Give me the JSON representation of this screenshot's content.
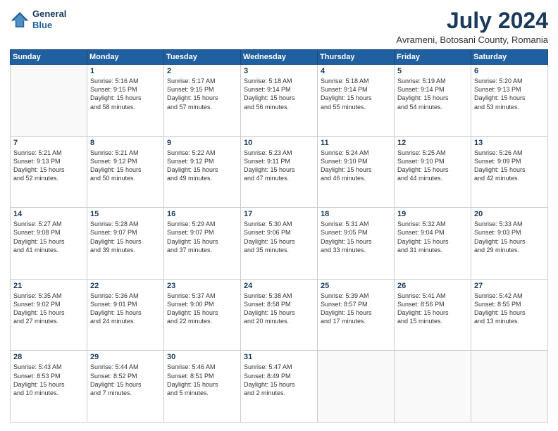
{
  "logo": {
    "line1": "General",
    "line2": "Blue"
  },
  "title": "July 2024",
  "subtitle": "Avrameni, Botosani County, Romania",
  "weekdays": [
    "Sunday",
    "Monday",
    "Tuesday",
    "Wednesday",
    "Thursday",
    "Friday",
    "Saturday"
  ],
  "weeks": [
    [
      {
        "day": "",
        "text": ""
      },
      {
        "day": "1",
        "text": "Sunrise: 5:16 AM\nSunset: 9:15 PM\nDaylight: 15 hours\nand 58 minutes."
      },
      {
        "day": "2",
        "text": "Sunrise: 5:17 AM\nSunset: 9:15 PM\nDaylight: 15 hours\nand 57 minutes."
      },
      {
        "day": "3",
        "text": "Sunrise: 5:18 AM\nSunset: 9:14 PM\nDaylight: 15 hours\nand 56 minutes."
      },
      {
        "day": "4",
        "text": "Sunrise: 5:18 AM\nSunset: 9:14 PM\nDaylight: 15 hours\nand 55 minutes."
      },
      {
        "day": "5",
        "text": "Sunrise: 5:19 AM\nSunset: 9:14 PM\nDaylight: 15 hours\nand 54 minutes."
      },
      {
        "day": "6",
        "text": "Sunrise: 5:20 AM\nSunset: 9:13 PM\nDaylight: 15 hours\nand 53 minutes."
      }
    ],
    [
      {
        "day": "7",
        "text": "Sunrise: 5:21 AM\nSunset: 9:13 PM\nDaylight: 15 hours\nand 52 minutes."
      },
      {
        "day": "8",
        "text": "Sunrise: 5:21 AM\nSunset: 9:12 PM\nDaylight: 15 hours\nand 50 minutes."
      },
      {
        "day": "9",
        "text": "Sunrise: 5:22 AM\nSunset: 9:12 PM\nDaylight: 15 hours\nand 49 minutes."
      },
      {
        "day": "10",
        "text": "Sunrise: 5:23 AM\nSunset: 9:11 PM\nDaylight: 15 hours\nand 47 minutes."
      },
      {
        "day": "11",
        "text": "Sunrise: 5:24 AM\nSunset: 9:10 PM\nDaylight: 15 hours\nand 46 minutes."
      },
      {
        "day": "12",
        "text": "Sunrise: 5:25 AM\nSunset: 9:10 PM\nDaylight: 15 hours\nand 44 minutes."
      },
      {
        "day": "13",
        "text": "Sunrise: 5:26 AM\nSunset: 9:09 PM\nDaylight: 15 hours\nand 42 minutes."
      }
    ],
    [
      {
        "day": "14",
        "text": "Sunrise: 5:27 AM\nSunset: 9:08 PM\nDaylight: 15 hours\nand 41 minutes."
      },
      {
        "day": "15",
        "text": "Sunrise: 5:28 AM\nSunset: 9:07 PM\nDaylight: 15 hours\nand 39 minutes."
      },
      {
        "day": "16",
        "text": "Sunrise: 5:29 AM\nSunset: 9:07 PM\nDaylight: 15 hours\nand 37 minutes."
      },
      {
        "day": "17",
        "text": "Sunrise: 5:30 AM\nSunset: 9:06 PM\nDaylight: 15 hours\nand 35 minutes."
      },
      {
        "day": "18",
        "text": "Sunrise: 5:31 AM\nSunset: 9:05 PM\nDaylight: 15 hours\nand 33 minutes."
      },
      {
        "day": "19",
        "text": "Sunrise: 5:32 AM\nSunset: 9:04 PM\nDaylight: 15 hours\nand 31 minutes."
      },
      {
        "day": "20",
        "text": "Sunrise: 5:33 AM\nSunset: 9:03 PM\nDaylight: 15 hours\nand 29 minutes."
      }
    ],
    [
      {
        "day": "21",
        "text": "Sunrise: 5:35 AM\nSunset: 9:02 PM\nDaylight: 15 hours\nand 27 minutes."
      },
      {
        "day": "22",
        "text": "Sunrise: 5:36 AM\nSunset: 9:01 PM\nDaylight: 15 hours\nand 24 minutes."
      },
      {
        "day": "23",
        "text": "Sunrise: 5:37 AM\nSunset: 9:00 PM\nDaylight: 15 hours\nand 22 minutes."
      },
      {
        "day": "24",
        "text": "Sunrise: 5:38 AM\nSunset: 8:58 PM\nDaylight: 15 hours\nand 20 minutes."
      },
      {
        "day": "25",
        "text": "Sunrise: 5:39 AM\nSunset: 8:57 PM\nDaylight: 15 hours\nand 17 minutes."
      },
      {
        "day": "26",
        "text": "Sunrise: 5:41 AM\nSunset: 8:56 PM\nDaylight: 15 hours\nand 15 minutes."
      },
      {
        "day": "27",
        "text": "Sunrise: 5:42 AM\nSunset: 8:55 PM\nDaylight: 15 hours\nand 13 minutes."
      }
    ],
    [
      {
        "day": "28",
        "text": "Sunrise: 5:43 AM\nSunset: 8:53 PM\nDaylight: 15 hours\nand 10 minutes."
      },
      {
        "day": "29",
        "text": "Sunrise: 5:44 AM\nSunset: 8:52 PM\nDaylight: 15 hours\nand 7 minutes."
      },
      {
        "day": "30",
        "text": "Sunrise: 5:46 AM\nSunset: 8:51 PM\nDaylight: 15 hours\nand 5 minutes."
      },
      {
        "day": "31",
        "text": "Sunrise: 5:47 AM\nSunset: 8:49 PM\nDaylight: 15 hours\nand 2 minutes."
      },
      {
        "day": "",
        "text": ""
      },
      {
        "day": "",
        "text": ""
      },
      {
        "day": "",
        "text": ""
      }
    ]
  ]
}
